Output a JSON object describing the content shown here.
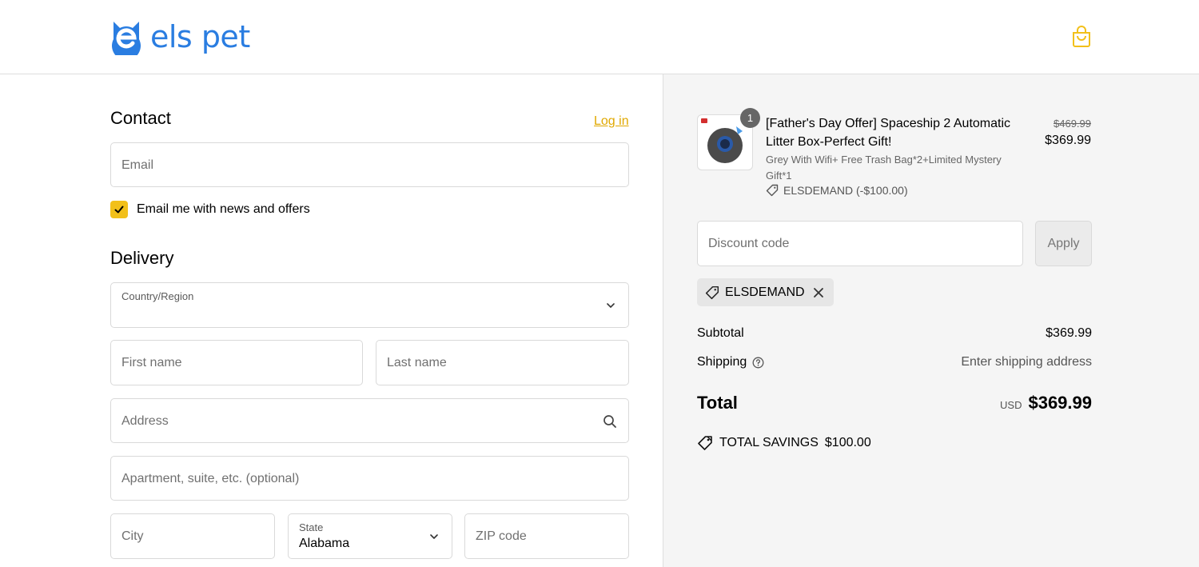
{
  "header": {
    "logo_text": "els pet",
    "bag_icon": "shopping-bag-icon",
    "accent_color": "#f2c01a",
    "brand_color": "#2a7de1"
  },
  "contact": {
    "title": "Contact",
    "login_label": "Log in",
    "email_placeholder": "Email",
    "newsletter_label": "Email me with news and offers",
    "newsletter_checked": true
  },
  "delivery": {
    "title": "Delivery",
    "country_label": "Country/Region",
    "country_value": "",
    "first_name_placeholder": "First name",
    "last_name_placeholder": "Last name",
    "address_placeholder": "Address",
    "apartment_placeholder": "Apartment, suite, etc. (optional)",
    "city_placeholder": "City",
    "state_label": "State",
    "state_value": "Alabama",
    "zip_placeholder": "ZIP code"
  },
  "order": {
    "item": {
      "quantity": "1",
      "title": "[Father's Day Offer] Spaceship 2 Automatic Litter Box-Perfect Gift!",
      "variant": "Grey With Wifi+ Free Trash Bag*2+Limited Mystery Gift*1",
      "discount_line": "ELSDEMAND (-$100.00)",
      "price_original": "$469.99",
      "price_current": "$369.99"
    },
    "discount_placeholder": "Discount code",
    "apply_label": "Apply",
    "applied_code": "ELSDEMAND",
    "subtotal_label": "Subtotal",
    "subtotal_value": "$369.99",
    "shipping_label": "Shipping",
    "shipping_value": "Enter shipping address",
    "total_label": "Total",
    "total_currency": "USD",
    "total_value": "$369.99",
    "savings_label": "TOTAL SAVINGS",
    "savings_value": "$100.00"
  }
}
